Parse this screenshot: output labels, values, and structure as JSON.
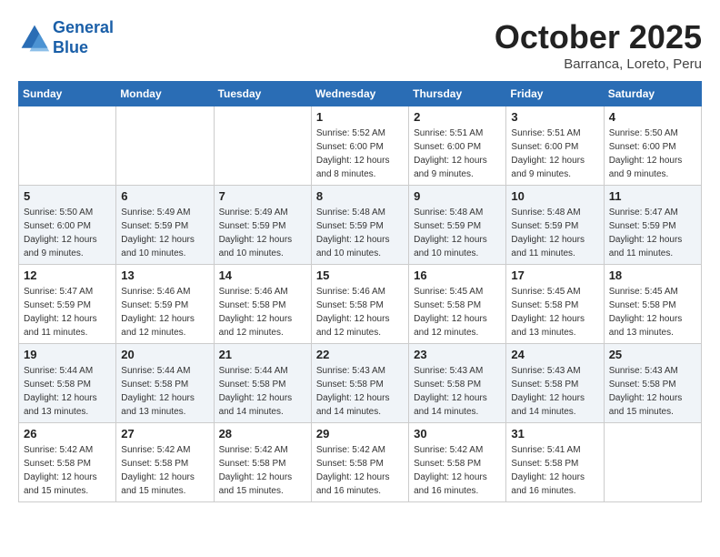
{
  "header": {
    "logo": {
      "line1": "General",
      "line2": "Blue"
    },
    "month": "October 2025",
    "location": "Barranca, Loreto, Peru"
  },
  "days_of_week": [
    "Sunday",
    "Monday",
    "Tuesday",
    "Wednesday",
    "Thursday",
    "Friday",
    "Saturday"
  ],
  "weeks": [
    [
      {
        "day": "",
        "info": ""
      },
      {
        "day": "",
        "info": ""
      },
      {
        "day": "",
        "info": ""
      },
      {
        "day": "1",
        "info": "Sunrise: 5:52 AM\nSunset: 6:00 PM\nDaylight: 12 hours\nand 8 minutes."
      },
      {
        "day": "2",
        "info": "Sunrise: 5:51 AM\nSunset: 6:00 PM\nDaylight: 12 hours\nand 9 minutes."
      },
      {
        "day": "3",
        "info": "Sunrise: 5:51 AM\nSunset: 6:00 PM\nDaylight: 12 hours\nand 9 minutes."
      },
      {
        "day": "4",
        "info": "Sunrise: 5:50 AM\nSunset: 6:00 PM\nDaylight: 12 hours\nand 9 minutes."
      }
    ],
    [
      {
        "day": "5",
        "info": "Sunrise: 5:50 AM\nSunset: 6:00 PM\nDaylight: 12 hours\nand 9 minutes."
      },
      {
        "day": "6",
        "info": "Sunrise: 5:49 AM\nSunset: 5:59 PM\nDaylight: 12 hours\nand 10 minutes."
      },
      {
        "day": "7",
        "info": "Sunrise: 5:49 AM\nSunset: 5:59 PM\nDaylight: 12 hours\nand 10 minutes."
      },
      {
        "day": "8",
        "info": "Sunrise: 5:48 AM\nSunset: 5:59 PM\nDaylight: 12 hours\nand 10 minutes."
      },
      {
        "day": "9",
        "info": "Sunrise: 5:48 AM\nSunset: 5:59 PM\nDaylight: 12 hours\nand 10 minutes."
      },
      {
        "day": "10",
        "info": "Sunrise: 5:48 AM\nSunset: 5:59 PM\nDaylight: 12 hours\nand 11 minutes."
      },
      {
        "day": "11",
        "info": "Sunrise: 5:47 AM\nSunset: 5:59 PM\nDaylight: 12 hours\nand 11 minutes."
      }
    ],
    [
      {
        "day": "12",
        "info": "Sunrise: 5:47 AM\nSunset: 5:59 PM\nDaylight: 12 hours\nand 11 minutes."
      },
      {
        "day": "13",
        "info": "Sunrise: 5:46 AM\nSunset: 5:59 PM\nDaylight: 12 hours\nand 12 minutes."
      },
      {
        "day": "14",
        "info": "Sunrise: 5:46 AM\nSunset: 5:58 PM\nDaylight: 12 hours\nand 12 minutes."
      },
      {
        "day": "15",
        "info": "Sunrise: 5:46 AM\nSunset: 5:58 PM\nDaylight: 12 hours\nand 12 minutes."
      },
      {
        "day": "16",
        "info": "Sunrise: 5:45 AM\nSunset: 5:58 PM\nDaylight: 12 hours\nand 12 minutes."
      },
      {
        "day": "17",
        "info": "Sunrise: 5:45 AM\nSunset: 5:58 PM\nDaylight: 12 hours\nand 13 minutes."
      },
      {
        "day": "18",
        "info": "Sunrise: 5:45 AM\nSunset: 5:58 PM\nDaylight: 12 hours\nand 13 minutes."
      }
    ],
    [
      {
        "day": "19",
        "info": "Sunrise: 5:44 AM\nSunset: 5:58 PM\nDaylight: 12 hours\nand 13 minutes."
      },
      {
        "day": "20",
        "info": "Sunrise: 5:44 AM\nSunset: 5:58 PM\nDaylight: 12 hours\nand 13 minutes."
      },
      {
        "day": "21",
        "info": "Sunrise: 5:44 AM\nSunset: 5:58 PM\nDaylight: 12 hours\nand 14 minutes."
      },
      {
        "day": "22",
        "info": "Sunrise: 5:43 AM\nSunset: 5:58 PM\nDaylight: 12 hours\nand 14 minutes."
      },
      {
        "day": "23",
        "info": "Sunrise: 5:43 AM\nSunset: 5:58 PM\nDaylight: 12 hours\nand 14 minutes."
      },
      {
        "day": "24",
        "info": "Sunrise: 5:43 AM\nSunset: 5:58 PM\nDaylight: 12 hours\nand 14 minutes."
      },
      {
        "day": "25",
        "info": "Sunrise: 5:43 AM\nSunset: 5:58 PM\nDaylight: 12 hours\nand 15 minutes."
      }
    ],
    [
      {
        "day": "26",
        "info": "Sunrise: 5:42 AM\nSunset: 5:58 PM\nDaylight: 12 hours\nand 15 minutes."
      },
      {
        "day": "27",
        "info": "Sunrise: 5:42 AM\nSunset: 5:58 PM\nDaylight: 12 hours\nand 15 minutes."
      },
      {
        "day": "28",
        "info": "Sunrise: 5:42 AM\nSunset: 5:58 PM\nDaylight: 12 hours\nand 15 minutes."
      },
      {
        "day": "29",
        "info": "Sunrise: 5:42 AM\nSunset: 5:58 PM\nDaylight: 12 hours\nand 16 minutes."
      },
      {
        "day": "30",
        "info": "Sunrise: 5:42 AM\nSunset: 5:58 PM\nDaylight: 12 hours\nand 16 minutes."
      },
      {
        "day": "31",
        "info": "Sunrise: 5:41 AM\nSunset: 5:58 PM\nDaylight: 12 hours\nand 16 minutes."
      },
      {
        "day": "",
        "info": ""
      }
    ]
  ]
}
